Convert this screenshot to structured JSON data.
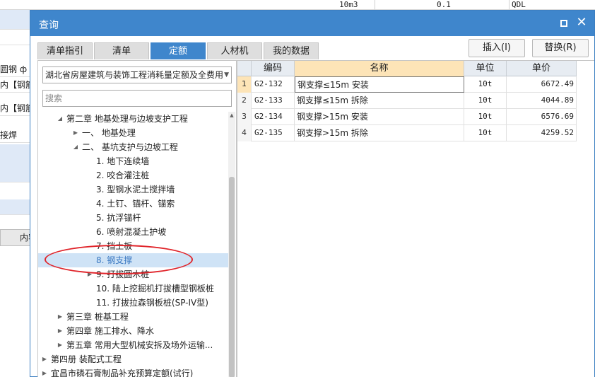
{
  "background": {
    "top_row": {
      "qty_unit": "10m3",
      "qty_value": "0.1",
      "code": "QDL"
    },
    "left_cells": [
      "圆钢 ф",
      "内【钢筋",
      "内【钢筋",
      "接焊"
    ],
    "bottom_tab": "内容"
  },
  "dialog": {
    "title": "查询",
    "tabs": [
      "清单指引",
      "清单",
      "定额",
      "人材机",
      "我的数据"
    ],
    "active_tab": 2,
    "insert_label": "插入(I)",
    "replace_label": "替换(R)"
  },
  "left_panel": {
    "quota_library": "湖北省房屋建筑与装饰工程消耗量定额及全费用",
    "search_placeholder": "搜索",
    "tree": [
      {
        "label": "第二章 地基处理与边坡支护工程",
        "level": 1,
        "expander": "expanded"
      },
      {
        "label": "一、 地基处理",
        "level": 2,
        "expander": "collapsed"
      },
      {
        "label": "二、 基坑支护与边坡工程",
        "level": 2,
        "expander": "expanded"
      },
      {
        "label": "1. 地下连续墙",
        "level": 3,
        "expander": "none"
      },
      {
        "label": "2. 咬合灌注桩",
        "level": 3,
        "expander": "none"
      },
      {
        "label": "3. 型钢水泥土搅拌墙",
        "level": 3,
        "expander": "none"
      },
      {
        "label": "4. 土钉、锚杆、锚索",
        "level": 3,
        "expander": "none"
      },
      {
        "label": "5. 抗浮锚杆",
        "level": 3,
        "expander": "none"
      },
      {
        "label": "6. 喷射混凝土护坡",
        "level": 3,
        "expander": "none"
      },
      {
        "label": "7. 挡土板",
        "level": 3,
        "expander": "none"
      },
      {
        "label": "8. 钢支撑",
        "level": 3,
        "expander": "none",
        "selected": true
      },
      {
        "label": "9. 打拔圆木桩",
        "level": 3,
        "expander": "collapsed"
      },
      {
        "label": "10. 陆上挖掘机打拔槽型钢板桩",
        "level": 3,
        "expander": "none"
      },
      {
        "label": "11. 打拔拉森钢板桩(SP-IV型)",
        "level": 3,
        "expander": "none"
      },
      {
        "label": "第三章 桩基工程",
        "level": 1,
        "expander": "collapsed"
      },
      {
        "label": "第四章 施工排水、降水",
        "level": 1,
        "expander": "collapsed"
      },
      {
        "label": "第五章 常用大型机械安拆及场外运输...",
        "level": 1,
        "expander": "collapsed"
      },
      {
        "label": "第四册 装配式工程",
        "level": 0,
        "expander": "collapsed"
      },
      {
        "label": "宜昌市磷石膏制品补充预算定额(试行)",
        "level": 0,
        "expander": "collapsed"
      }
    ]
  },
  "grid": {
    "columns": [
      "",
      "编码",
      "名称",
      "单位",
      "单价"
    ],
    "rows": [
      {
        "num": "1",
        "code": "G2-132",
        "name": "钢支撑≤15m 安装",
        "unit": "10t",
        "price": "6672.49"
      },
      {
        "num": "2",
        "code": "G2-133",
        "name": "钢支撑≤15m 拆除",
        "unit": "10t",
        "price": "4044.89"
      },
      {
        "num": "3",
        "code": "G2-134",
        "name": "钢支撑>15m 安装",
        "unit": "10t",
        "price": "6576.69"
      },
      {
        "num": "4",
        "code": "G2-135",
        "name": "钢支撑>15m 拆除",
        "unit": "10t",
        "price": "4259.52"
      }
    ],
    "selected_row": 0
  },
  "colors": {
    "title_bar": "#3f86cc",
    "active_tab": "#3f86cc",
    "selected_tree": "#cfe3f6",
    "active_header": "#fde4b7",
    "annotation": "#e0252b"
  },
  "icons": [
    "maximize-icon",
    "close-icon",
    "chevron-down-icon",
    "expand-arrow-icon",
    "collapse-arrow-icon",
    "scroll-up-icon"
  ]
}
